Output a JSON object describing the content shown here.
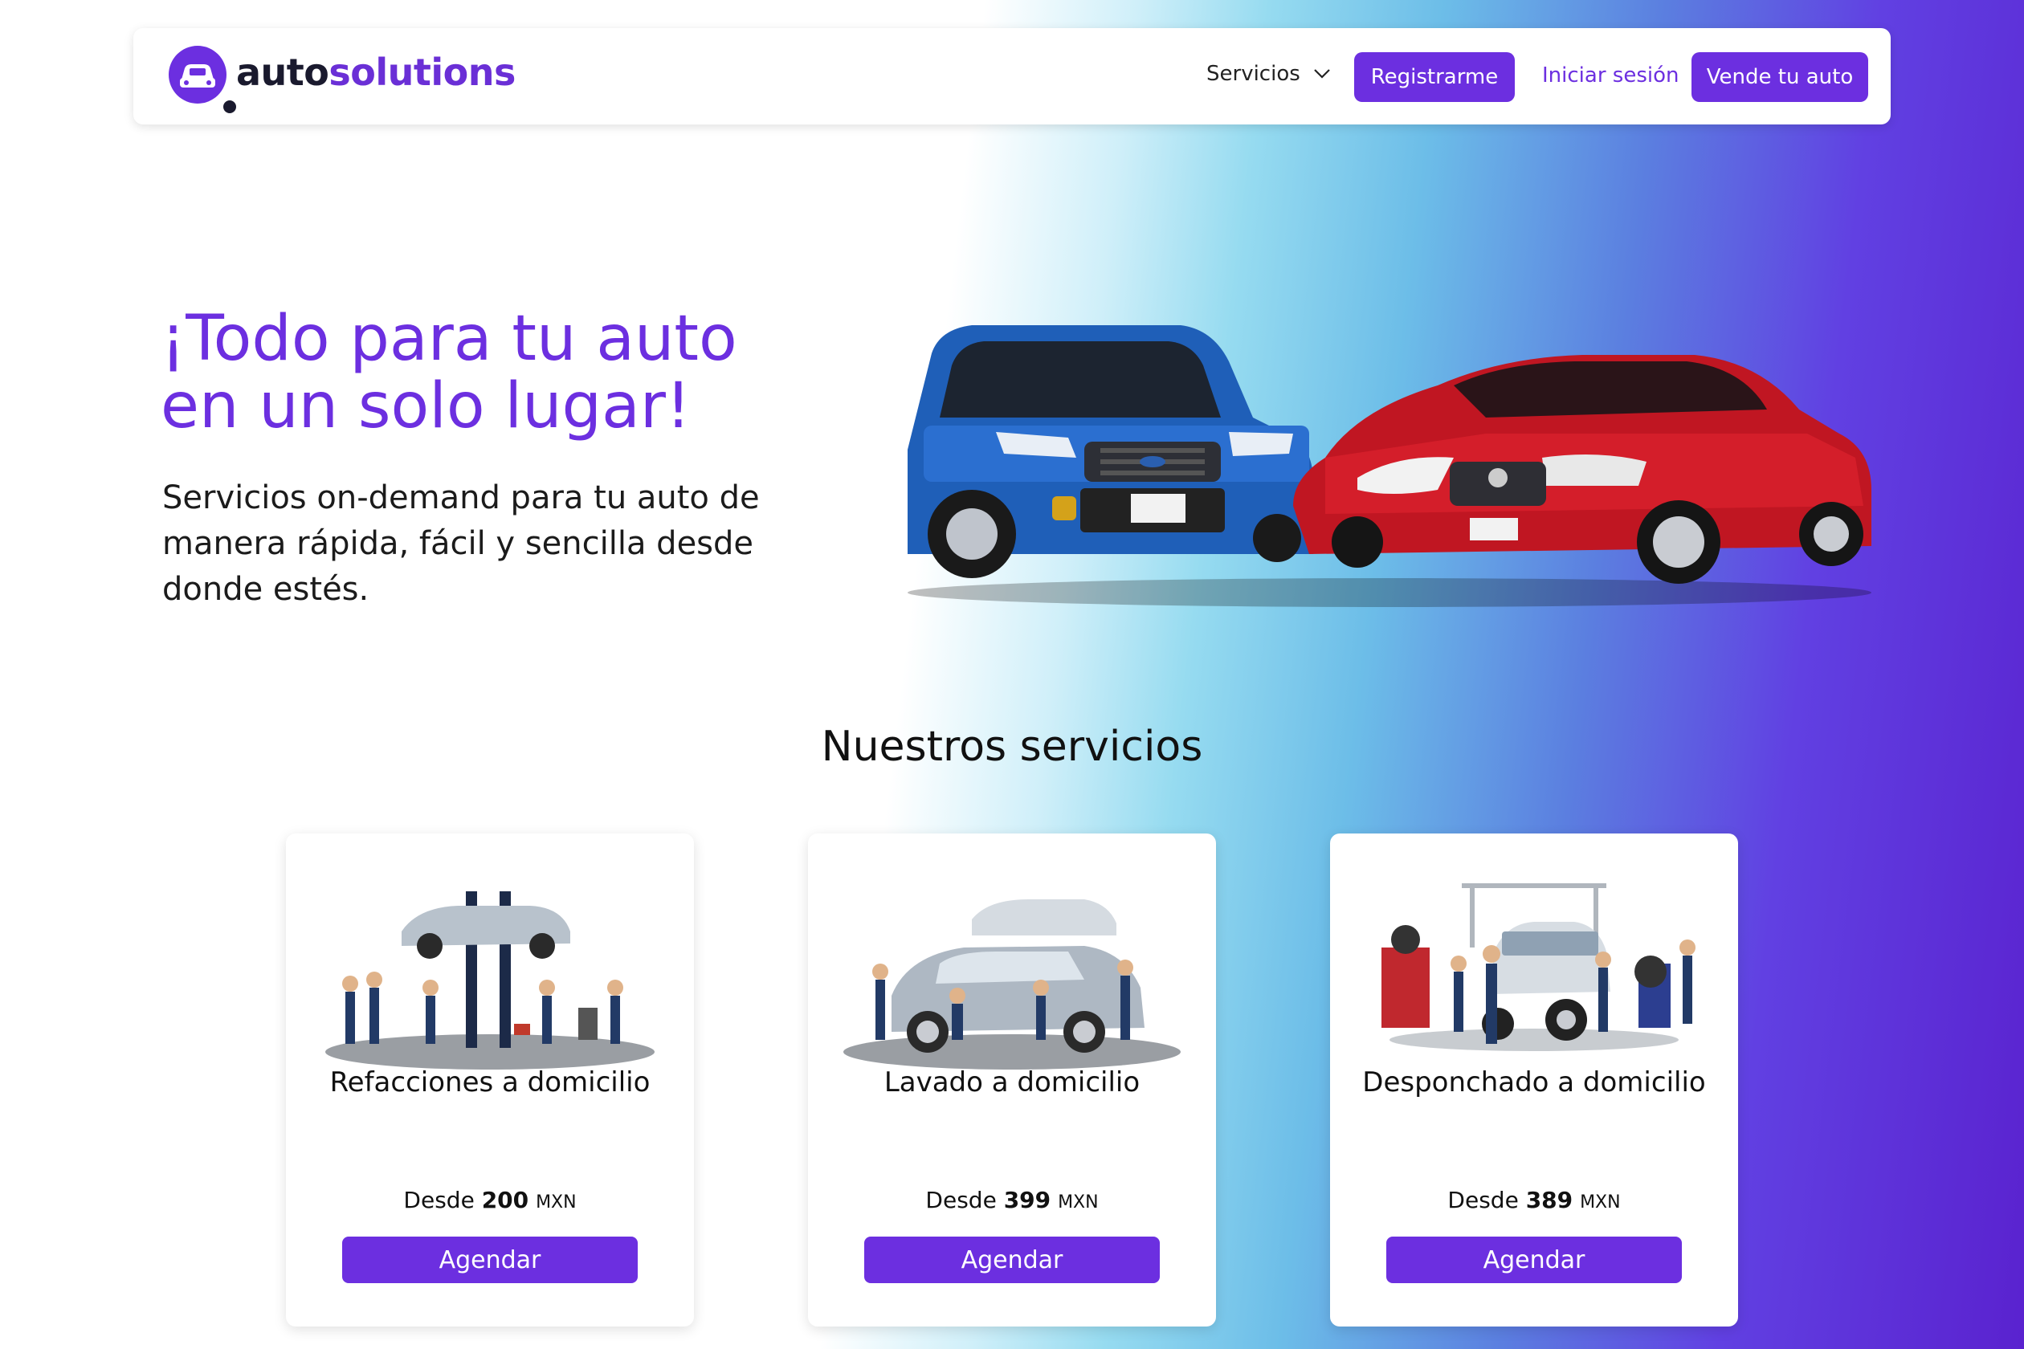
{
  "brand": {
    "part1": "auto",
    "part2": "solutions",
    "accent_color": "#6c2fe0"
  },
  "nav": {
    "services_label": "Servicios",
    "register_label": "Registrarme",
    "login_label": "Iniciar sesión",
    "sell_label": "Vende tu auto"
  },
  "hero": {
    "title_line1": "¡Todo para tu auto",
    "title_line2": "en un solo lugar!",
    "subtitle": "Servicios on-demand para tu auto de manera rápida, fácil y sencilla desde donde estés."
  },
  "services": {
    "title": "Nuestros servicios",
    "cards": [
      {
        "title": "Refacciones a domicilio",
        "price_prefix": "Desde",
        "price": "200",
        "currency": "MXN",
        "button": "Agendar"
      },
      {
        "title": "Lavado a domicilio",
        "price_prefix": "Desde",
        "price": "399",
        "currency": "MXN",
        "button": "Agendar"
      },
      {
        "title": "Desponchado a domicilio",
        "price_prefix": "Desde",
        "price": "389",
        "currency": "MXN",
        "button": "Agendar"
      }
    ]
  }
}
